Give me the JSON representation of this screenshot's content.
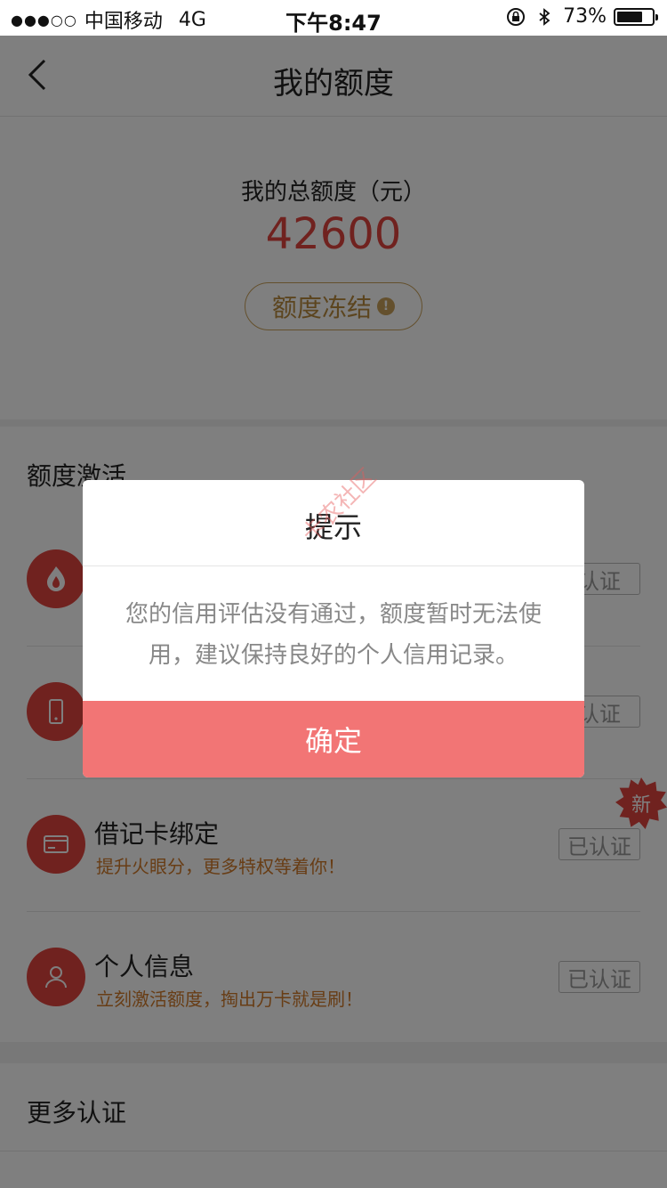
{
  "status_bar": {
    "signal": "●●●○○",
    "carrier": "中国移动",
    "network": "4G",
    "time": "下午8:47",
    "battery": "73%",
    "battery_level": 0.73
  },
  "nav": {
    "title": "我的额度"
  },
  "summary": {
    "label": "我的总额度（元）",
    "amount": "42600",
    "freeze_label": "额度冻结",
    "freeze_icon": "!"
  },
  "activation": {
    "header": "额度激活",
    "items": [
      {
        "title": "",
        "subtitle": "",
        "status": "认证",
        "icon": "fire-icon"
      },
      {
        "title": "",
        "subtitle": "",
        "status": "认证",
        "icon": "phone-icon"
      },
      {
        "title": "借记卡绑定",
        "subtitle": "提升火眼分，更多特权等着你！",
        "status": "已认证",
        "icon": "card-icon",
        "badge": "新"
      },
      {
        "title": "个人信息",
        "subtitle": "立刻激活额度，掏出万卡就是刷！",
        "status": "已认证",
        "icon": "person-icon"
      }
    ]
  },
  "more": {
    "header": "更多认证"
  },
  "dialog": {
    "title": "提示",
    "message": "您的信用评估没有通过，额度暂时无法使用，建议保持良好的个人信用记录。",
    "confirm": "确定"
  },
  "watermark": "卡农社区",
  "colors": {
    "accent": "#e0443f",
    "confirm": "#f27575",
    "gold": "#c9a15b"
  }
}
